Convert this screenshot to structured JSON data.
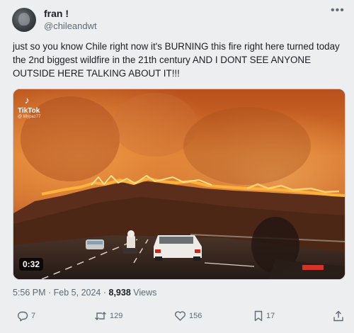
{
  "tweet": {
    "display_name": "fran !",
    "handle": "@chileandwt",
    "text": "just so you know Chile right now it's BURNING this fire right here turned today the 2nd biggest wildfire in the 21th century AND I DONT SEE ANYONE OUTSIDE HERE TALKING ABOUT IT!!!",
    "more_icon": "•••"
  },
  "video": {
    "tiktok_label": "TikTok",
    "tiktok_handle": "@ lillypaz77",
    "duration": "0:32"
  },
  "meta": {
    "time_date": "5:56 PM · Feb 5, 2024 · ",
    "views_count": "8,938",
    "views_label": " Views"
  },
  "actions": {
    "reply_count": "7",
    "repost_count": "129",
    "like_count": "156",
    "bookmark_count": "17"
  },
  "icons": [
    "more-icon",
    "tiktok-icon",
    "reply-icon",
    "repost-icon",
    "like-icon",
    "bookmark-icon",
    "share-icon"
  ],
  "colors": {
    "background": "#eceef0",
    "text": "#1b1f24",
    "secondary_text": "#5f6a74",
    "fire": "#ff8a1c",
    "smoke": "#c0622a"
  }
}
